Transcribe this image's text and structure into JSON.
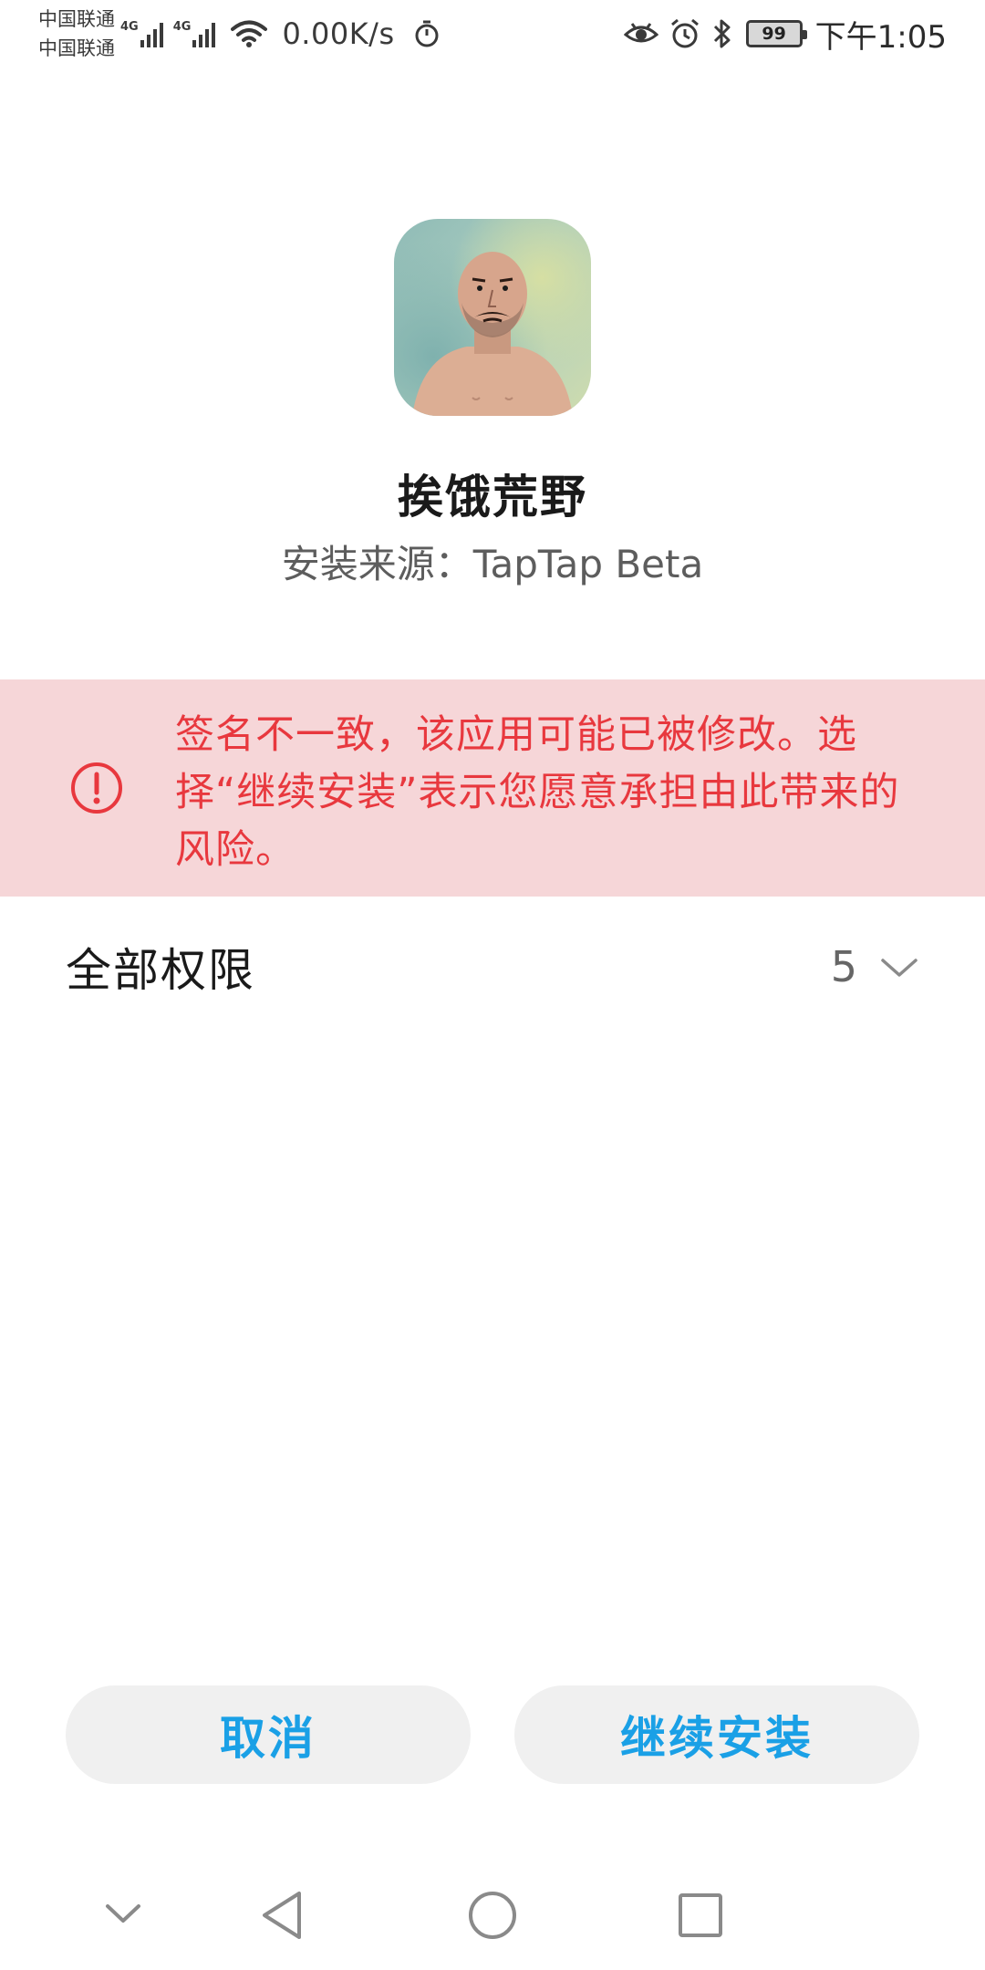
{
  "status_bar": {
    "carrier_1": "中国联通",
    "carrier_2": "中国联通",
    "network_1": "4G",
    "network_2": "4G",
    "net_speed": "0.00K/s",
    "battery": "99",
    "time": "下午1:05",
    "icons": [
      "signal-icon",
      "wifi-icon",
      "stopwatch-icon",
      "eye-icon",
      "alarm-icon",
      "bluetooth-icon",
      "battery-icon"
    ]
  },
  "app": {
    "name": "挨饿荒野",
    "source": "安装来源：TapTap Beta",
    "icon": "app-icon-bald-man"
  },
  "warning": {
    "icon": "exclamation-circle-icon",
    "text": "签名不一致，该应用可能已被修改。选择“继续安装”表示您愿意承担由此带来的风险。",
    "color": "#e8383e",
    "background": "#f6d6d8"
  },
  "permissions": {
    "label": "全部权限",
    "count": "5",
    "icon": "chevron-down-icon"
  },
  "buttons": {
    "cancel": "取消",
    "install": "继续安装",
    "accent": "#1aa0e6"
  },
  "nav_bar": {
    "icons": [
      "hide-nav-icon",
      "back-icon",
      "home-icon",
      "recents-icon"
    ]
  }
}
